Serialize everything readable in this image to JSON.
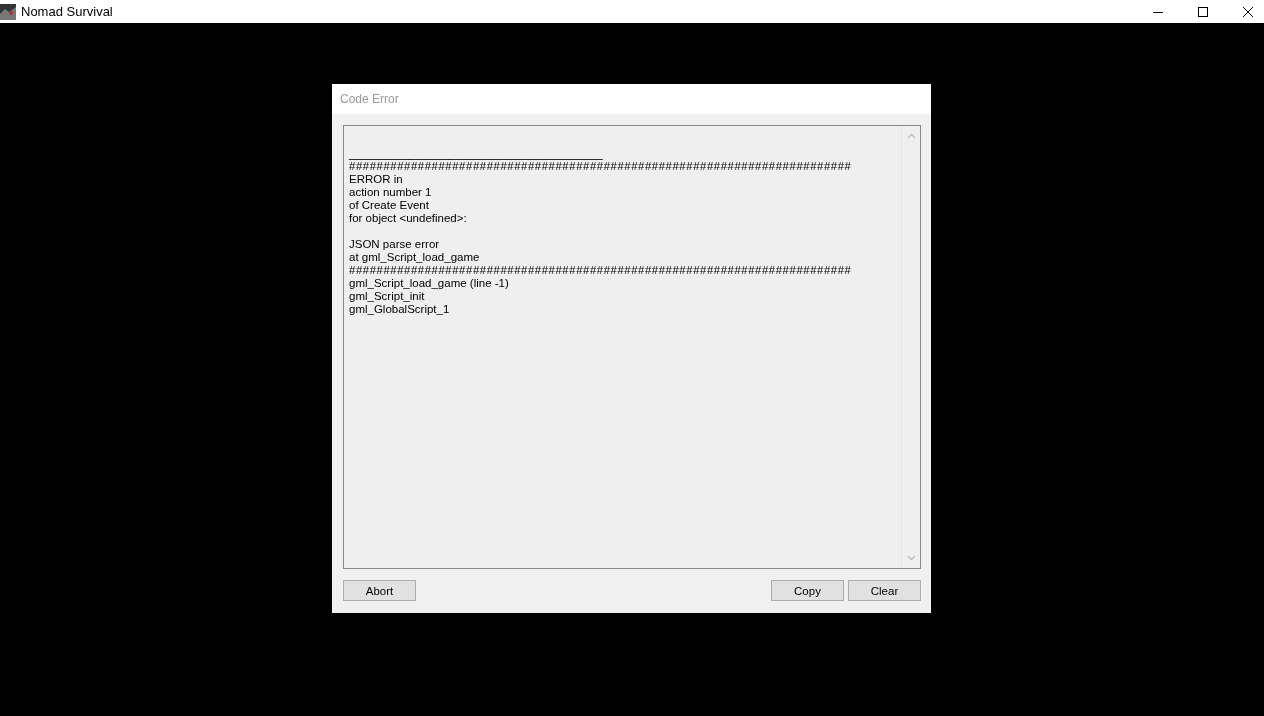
{
  "window": {
    "title": "Nomad Survival"
  },
  "dialog": {
    "title": "Code Error",
    "lines": [
      {
        "kind": "blank"
      },
      {
        "kind": "rule",
        "text": "______________________________________"
      },
      {
        "kind": "hashes",
        "text": "#########################################################################"
      },
      {
        "kind": "text",
        "text": "ERROR in"
      },
      {
        "kind": "text",
        "text": "action number 1"
      },
      {
        "kind": "text",
        "text": "of Create Event"
      },
      {
        "kind": "text",
        "text": "for object <undefined>:"
      },
      {
        "kind": "blank"
      },
      {
        "kind": "text",
        "text": "JSON parse error"
      },
      {
        "kind": "text",
        "text": "at gml_Script_load_game"
      },
      {
        "kind": "hashes",
        "text": "#########################################################################"
      },
      {
        "kind": "text",
        "text": "gml_Script_load_game (line -1)"
      },
      {
        "kind": "text",
        "text": "gml_Script_init"
      },
      {
        "kind": "text",
        "text": "gml_GlobalScript_1"
      }
    ],
    "buttons_left": [
      "Abort"
    ],
    "buttons_right": [
      "Copy",
      "Clear"
    ]
  }
}
